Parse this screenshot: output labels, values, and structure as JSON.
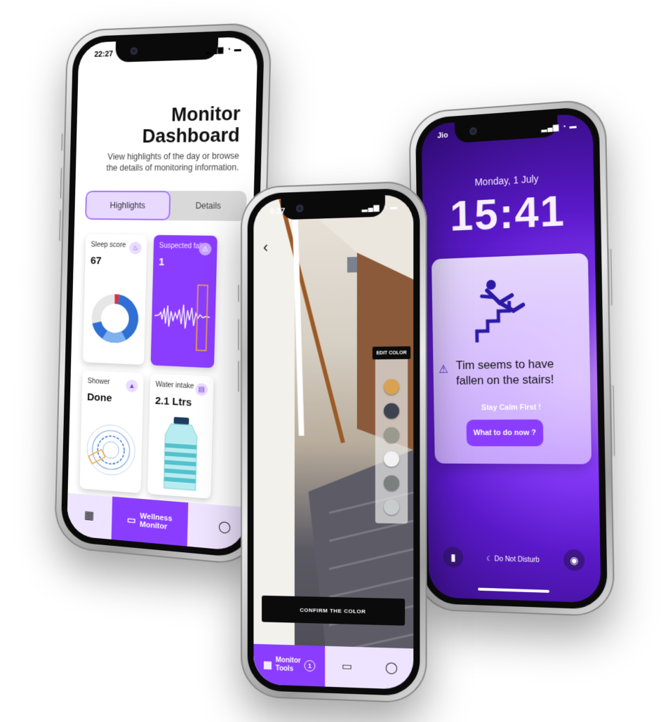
{
  "phone1": {
    "status_time": "22:27",
    "status_icons": "▂▄▆ ◔ ▬",
    "title_line1": "Monitor",
    "title_line2": "Dashboard",
    "subtitle": "View highlights of the day or browse the details of monitoring information.",
    "tabs": {
      "highlights": "Highlights",
      "details": "Details"
    },
    "cards": {
      "sleep": {
        "label": "Sleep score",
        "value": "67"
      },
      "fall": {
        "label": "Suspected fall",
        "value": "1"
      },
      "shower": {
        "label": "Shower",
        "value": "Done"
      },
      "water": {
        "label": "Water intake",
        "value": "2.1 Ltrs"
      }
    },
    "nav": {
      "center_label_line1": "Wellness",
      "center_label_line2": "Monitor"
    },
    "colors": {
      "accent": "#8b3dff",
      "accent_light": "#efe4ff"
    }
  },
  "phone2": {
    "status_time": "9:27",
    "status_icons": "▂▄▆ ◔ ▬",
    "back_glyph": "‹",
    "edit_color_label": "EDIT COLOR",
    "swatches": [
      "#d8a154",
      "#3e4352",
      "#9a9a8f",
      "#f2f2f2",
      "#7b7f7e",
      "#c9cccd"
    ],
    "confirm_label": "CONFIRM THE COLOR",
    "nav": {
      "center_label_line1": "Monitor",
      "center_label_line2": "Tools",
      "center_badge": "1"
    }
  },
  "phone3": {
    "carrier": "Jio",
    "status_icons": "▂▄▆ ◔ ▬",
    "date": "Monday, 1 July",
    "time": "15:41",
    "alert_message": "Tim seems to have fallen on the stairs!",
    "calm_text": "Stay Calm First !",
    "action_label": "What to do now ?",
    "dnd_label": "Do Not Disturb"
  }
}
